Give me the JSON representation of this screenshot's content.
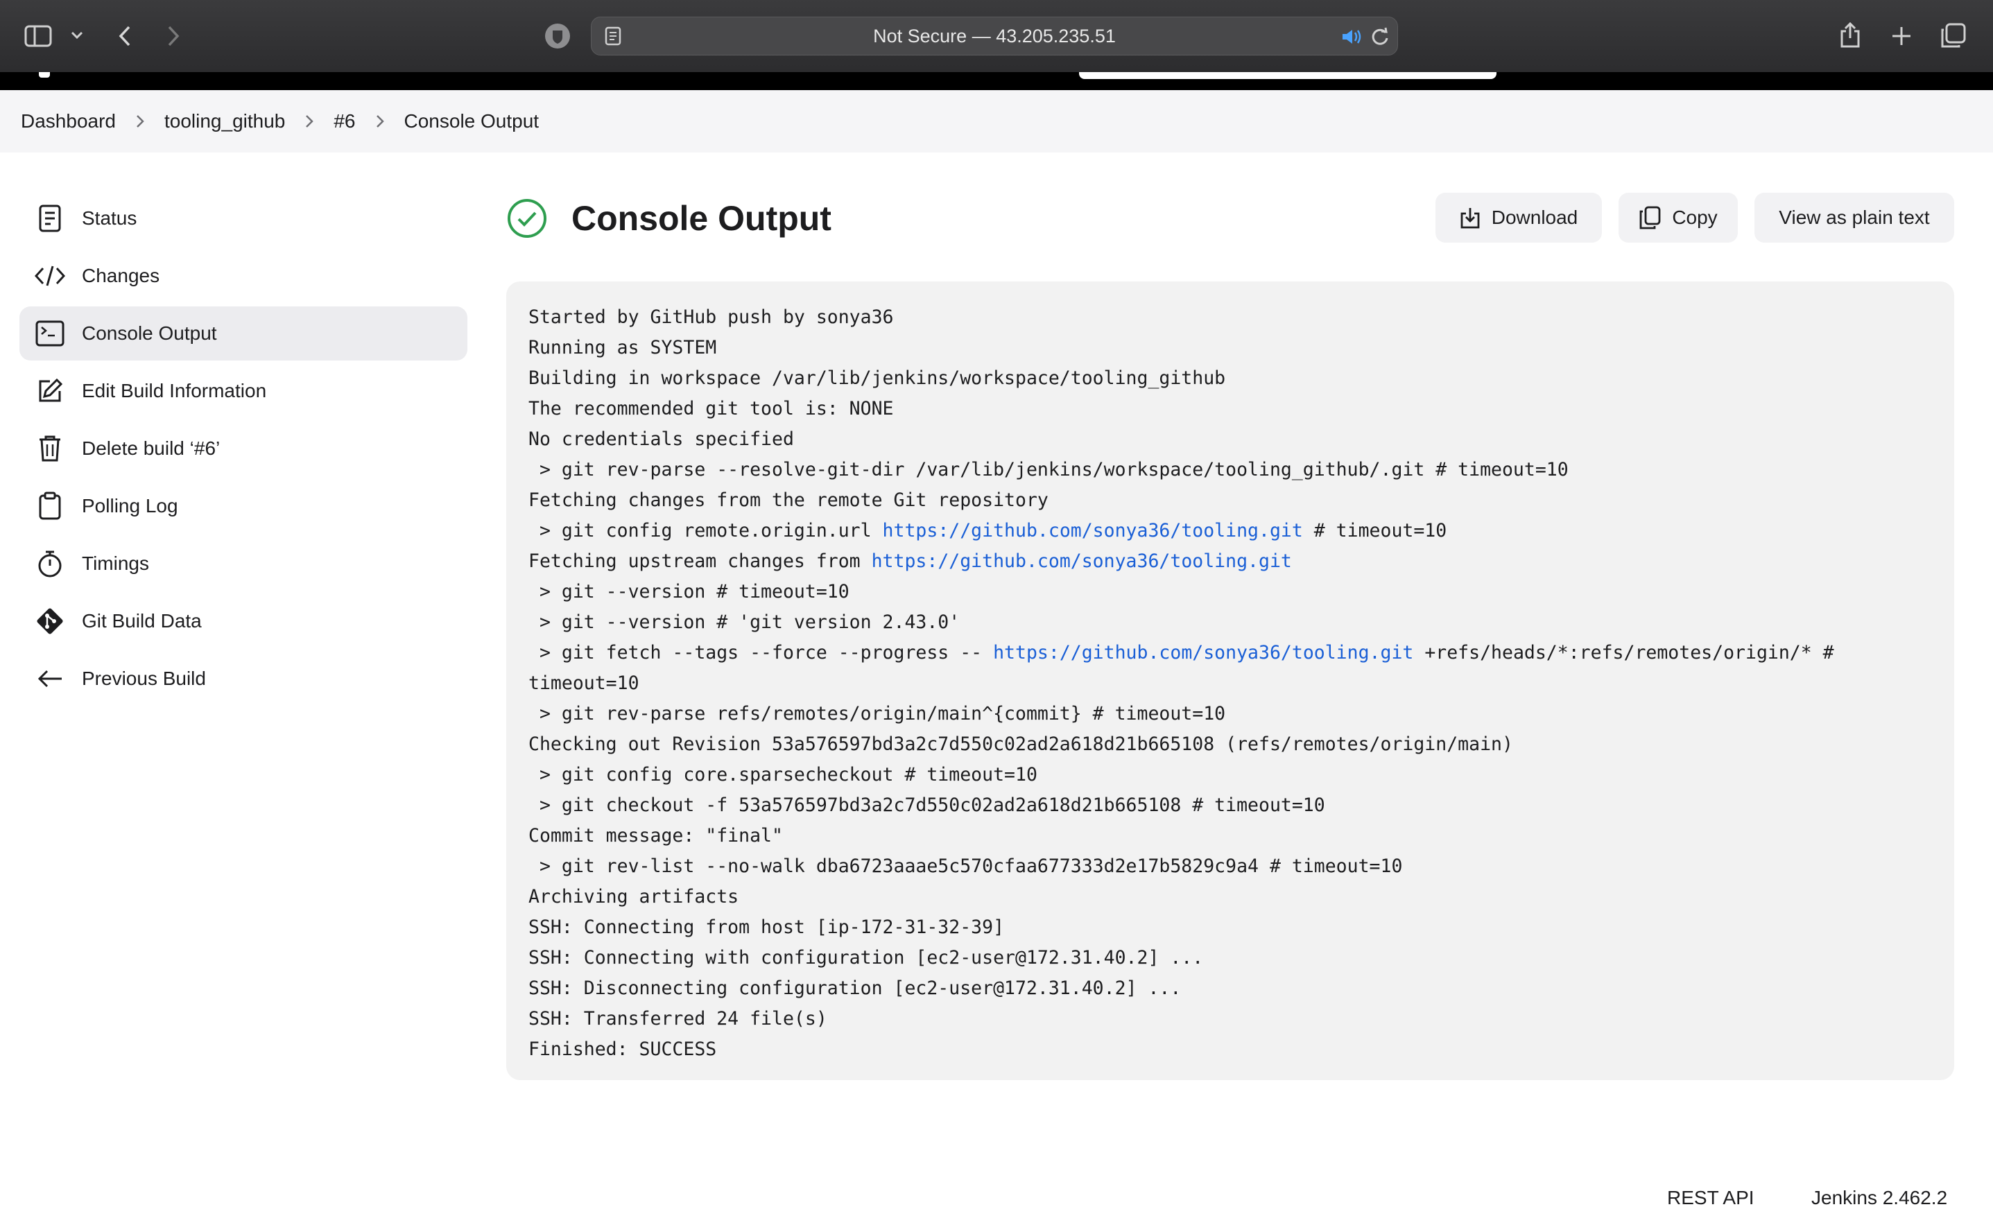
{
  "browser": {
    "address": "Not Secure — 43.205.235.51"
  },
  "breadcrumb": [
    "Dashboard",
    "tooling_github",
    "#6",
    "Console Output"
  ],
  "sidebar": {
    "items": [
      {
        "label": "Status",
        "icon": "document-icon"
      },
      {
        "label": "Changes",
        "icon": "code-icon"
      },
      {
        "label": "Console Output",
        "icon": "terminal-icon",
        "active": true
      },
      {
        "label": "Edit Build Information",
        "icon": "edit-icon"
      },
      {
        "label": "Delete build ‘#6’",
        "icon": "trash-icon"
      },
      {
        "label": "Polling Log",
        "icon": "clipboard-icon"
      },
      {
        "label": "Timings",
        "icon": "stopwatch-icon"
      },
      {
        "label": "Git Build Data",
        "icon": "git-icon"
      },
      {
        "label": "Previous Build",
        "icon": "arrow-left-icon"
      }
    ]
  },
  "page": {
    "title": "Console Output",
    "status": "success",
    "status_color": "#2e9e4f"
  },
  "actions": {
    "download": "Download",
    "copy": "Copy",
    "plain_text": "View as plain text"
  },
  "console": {
    "lines": [
      [
        "Started by GitHub push by sonya36"
      ],
      [
        "Running as SYSTEM"
      ],
      [
        "Building in workspace /var/lib/jenkins/workspace/tooling_github"
      ],
      [
        "The recommended git tool is: NONE"
      ],
      [
        "No credentials specified"
      ],
      [
        " > git rev-parse --resolve-git-dir /var/lib/jenkins/workspace/tooling_github/.git # timeout=10"
      ],
      [
        "Fetching changes from the remote Git repository"
      ],
      [
        " > git config remote.origin.url ",
        {
          "link": "https://github.com/sonya36/tooling.git"
        },
        " # timeout=10"
      ],
      [
        "Fetching upstream changes from ",
        {
          "link": "https://github.com/sonya36/tooling.git"
        }
      ],
      [
        " > git --version # timeout=10"
      ],
      [
        " > git --version # 'git version 2.43.0'"
      ],
      [
        " > git fetch --tags --force --progress -- ",
        {
          "link": "https://github.com/sonya36/tooling.git"
        },
        " +refs/heads/*:refs/remotes/origin/* #"
      ],
      [
        "timeout=10"
      ],
      [
        " > git rev-parse refs/remotes/origin/main^{commit} # timeout=10"
      ],
      [
        "Checking out Revision 53a576597bd3a2c7d550c02ad2a618d21b665108 (refs/remotes/origin/main)"
      ],
      [
        " > git config core.sparsecheckout # timeout=10"
      ],
      [
        " > git checkout -f 53a576597bd3a2c7d550c02ad2a618d21b665108 # timeout=10"
      ],
      [
        "Commit message: \"final\""
      ],
      [
        " > git rev-list --no-walk dba6723aaae5c570cfaa677333d2e17b5829c9a4 # timeout=10"
      ],
      [
        "Archiving artifacts"
      ],
      [
        "SSH: Connecting from host [ip-172-31-32-39]"
      ],
      [
        "SSH: Connecting with configuration [ec2-user@172.31.40.2] ..."
      ],
      [
        "SSH: Disconnecting configuration [ec2-user@172.31.40.2] ..."
      ],
      [
        "SSH: Transferred 24 file(s)"
      ],
      [
        "Finished: SUCCESS"
      ]
    ]
  },
  "footer": {
    "rest_api": "REST API",
    "version": "Jenkins 2.462.2"
  }
}
